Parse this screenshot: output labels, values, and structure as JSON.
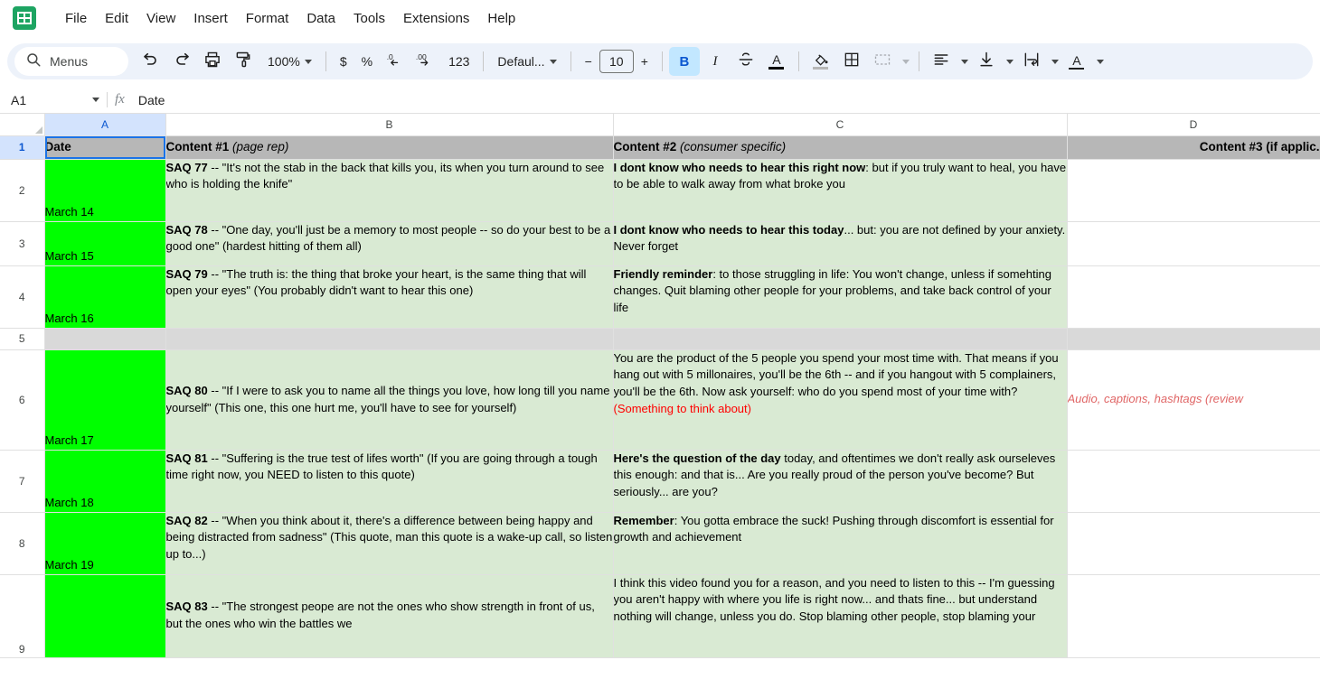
{
  "app": {
    "logo_icon": "sheets-logo-icon"
  },
  "menubar": {
    "items": [
      {
        "label": "File"
      },
      {
        "label": "Edit"
      },
      {
        "label": "View"
      },
      {
        "label": "Insert"
      },
      {
        "label": "Format"
      },
      {
        "label": "Data"
      },
      {
        "label": "Tools"
      },
      {
        "label": "Extensions"
      },
      {
        "label": "Help"
      }
    ]
  },
  "toolbar": {
    "search_label": "Menus",
    "search_icon": "search-icon",
    "undo_icon": "undo-icon",
    "redo_icon": "redo-icon",
    "print_icon": "print-icon",
    "paint_format_icon": "paint-format-icon",
    "zoom_value": "100%",
    "currency_label": "$",
    "percent_label": "%",
    "decrease_decimal_label": ".0",
    "increase_decimal_label": ".00",
    "number_format_label": "123",
    "font_name": "Defaul...",
    "font_decrease_label": "−",
    "font_size": "10",
    "font_increase_label": "+",
    "bold_label": "B",
    "italic_label": "I",
    "strikethrough_icon": "strikethrough-icon",
    "text_color_label": "A",
    "fill_color_icon": "fill-color-icon",
    "borders_icon": "borders-icon",
    "merge_cells_icon": "merge-cells-icon",
    "horizontal_align_icon": "horizontal-align-icon",
    "vertical_align_icon": "vertical-align-icon",
    "text_wrap_icon": "text-wrap-icon",
    "text_rotation_icon": "text-rotation-icon"
  },
  "formula_bar": {
    "name_box": "A1",
    "fx_label": "fx",
    "value": "Date"
  },
  "grid": {
    "columns": [
      {
        "id": "A",
        "label": "A",
        "selected": true
      },
      {
        "id": "B",
        "label": "B",
        "selected": false
      },
      {
        "id": "C",
        "label": "C",
        "selected": false
      },
      {
        "id": "D",
        "label": "D",
        "selected": false
      }
    ],
    "rows": [
      {
        "num": "1"
      },
      {
        "num": "2"
      },
      {
        "num": "3"
      },
      {
        "num": "4"
      },
      {
        "num": "5"
      },
      {
        "num": "6"
      },
      {
        "num": "7"
      },
      {
        "num": "8"
      },
      {
        "num": "9"
      }
    ],
    "header": {
      "a": "Date",
      "b_bold": "Content #1",
      "b_italic": "(page rep)",
      "c_bold": "Content #2",
      "c_italic": "(consumer specific)",
      "d": "Content #3 (if applic."
    },
    "r2": {
      "a": "March 14",
      "b_bold": "SAQ 77",
      "b_rest": " -- \"It's not the stab in the back that kills you, its when you turn around to see who is holding the knife\"",
      "c_bold": "I dont know who needs to hear this right now",
      "c_rest": ": but if you truly want to heal, you have to be able to walk away from what broke you",
      "d": ""
    },
    "r3": {
      "a": "March 15",
      "b_bold": "SAQ 78",
      "b_rest": " -- \"One day, you'll just be a memory to most people -- so do your best to be a good one\"  (hardest hitting of them all)",
      "c_bold": "I dont know who needs to hear this today",
      "c_rest": "... but: you are not defined by your anxiety. Never forget",
      "d": ""
    },
    "r4": {
      "a": "March 16",
      "b_bold": "SAQ 79",
      "b_rest": " -- \"The truth is: the thing that broke your heart, is the same thing that will open your eyes\" (You probably didn't want to hear this one)",
      "c_bold": "Friendly reminder",
      "c_rest": ": to those struggling in life: You won't change, unless if somehting changes. Quit blaming other people for your problems, and take back control of your life",
      "d": ""
    },
    "r5": {
      "a": "",
      "b": "",
      "c": "",
      "d": ""
    },
    "r6": {
      "a": "March 17",
      "b_bold": "SAQ 80",
      "b_rest": " -- \"If I were to ask you to name all the things you love, how long till you name yourself\" (This one, this one hurt me, you'll have to see for yourself)",
      "c_rest": "You are the product of the 5 people you spend your most time with. That means if you hang out with 5 millonaires, you'll be the 6th -- and if you hangout with 5 complainers, you'll be the 6th. Now ask yourself: who do you spend most of your time with? ",
      "c_red": "(Something to think about)",
      "d": "Audio, captions, hashtags (review"
    },
    "r7": {
      "a": "March 18",
      "b_bold": "SAQ 81",
      "b_rest": " -- \"Suffering is the true test of lifes worth\" (If you are going through a tough time right now, you NEED to listen to this quote)",
      "c_bold": "Here's the question of the day",
      "c_rest": " today, and oftentimes we don't really ask ourseleves this enough: and that is... Are you really proud of the person you've become? But seriously... are you?",
      "d": ""
    },
    "r8": {
      "a": "March 19",
      "b_bold": "SAQ 82",
      "b_rest": " -- \"When you think about it, there's a difference between being happy and being distracted from sadness\" (This quote, man this quote is a wake-up call, so listen up to...)",
      "c_bold": "Remember",
      "c_rest": ": You gotta embrace the suck! Pushing through discomfort is essential for growth and achievement",
      "d": ""
    },
    "r9": {
      "a": "",
      "b_bold": "SAQ 83",
      "b_rest": " -- \"The strongest peope are not the ones who show strength in front of us, but the ones who win the battles we",
      "c_rest": "I think this video found you for a reason, and you need to listen to this -- I'm guessing you aren't happy with where you life is right now... and thats fine... but understand nothing will change, unless you do. Stop blaming other people, stop blaming your",
      "d": ""
    }
  },
  "colors": {
    "date_fill": "#00ff00",
    "content_fill": "#d9ead3",
    "header_fill": "#b7b7b7",
    "spacer_fill": "#d9d9d9",
    "accent_red": "#ff0000",
    "note_red": "#e06666",
    "brand_green": "#1da462",
    "selection_blue": "#1a73e8"
  }
}
